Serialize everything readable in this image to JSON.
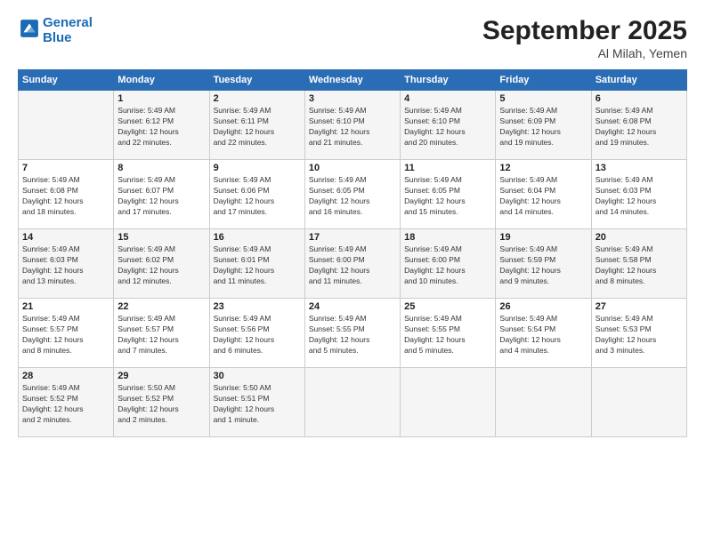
{
  "header": {
    "logo_line1": "General",
    "logo_line2": "Blue",
    "title": "September 2025",
    "subtitle": "Al Milah, Yemen"
  },
  "days_of_week": [
    "Sunday",
    "Monday",
    "Tuesday",
    "Wednesday",
    "Thursday",
    "Friday",
    "Saturday"
  ],
  "weeks": [
    [
      {
        "day": "",
        "info": ""
      },
      {
        "day": "1",
        "info": "Sunrise: 5:49 AM\nSunset: 6:12 PM\nDaylight: 12 hours\nand 22 minutes."
      },
      {
        "day": "2",
        "info": "Sunrise: 5:49 AM\nSunset: 6:11 PM\nDaylight: 12 hours\nand 22 minutes."
      },
      {
        "day": "3",
        "info": "Sunrise: 5:49 AM\nSunset: 6:10 PM\nDaylight: 12 hours\nand 21 minutes."
      },
      {
        "day": "4",
        "info": "Sunrise: 5:49 AM\nSunset: 6:10 PM\nDaylight: 12 hours\nand 20 minutes."
      },
      {
        "day": "5",
        "info": "Sunrise: 5:49 AM\nSunset: 6:09 PM\nDaylight: 12 hours\nand 19 minutes."
      },
      {
        "day": "6",
        "info": "Sunrise: 5:49 AM\nSunset: 6:08 PM\nDaylight: 12 hours\nand 19 minutes."
      }
    ],
    [
      {
        "day": "7",
        "info": "Sunrise: 5:49 AM\nSunset: 6:08 PM\nDaylight: 12 hours\nand 18 minutes."
      },
      {
        "day": "8",
        "info": "Sunrise: 5:49 AM\nSunset: 6:07 PM\nDaylight: 12 hours\nand 17 minutes."
      },
      {
        "day": "9",
        "info": "Sunrise: 5:49 AM\nSunset: 6:06 PM\nDaylight: 12 hours\nand 17 minutes."
      },
      {
        "day": "10",
        "info": "Sunrise: 5:49 AM\nSunset: 6:05 PM\nDaylight: 12 hours\nand 16 minutes."
      },
      {
        "day": "11",
        "info": "Sunrise: 5:49 AM\nSunset: 6:05 PM\nDaylight: 12 hours\nand 15 minutes."
      },
      {
        "day": "12",
        "info": "Sunrise: 5:49 AM\nSunset: 6:04 PM\nDaylight: 12 hours\nand 14 minutes."
      },
      {
        "day": "13",
        "info": "Sunrise: 5:49 AM\nSunset: 6:03 PM\nDaylight: 12 hours\nand 14 minutes."
      }
    ],
    [
      {
        "day": "14",
        "info": "Sunrise: 5:49 AM\nSunset: 6:03 PM\nDaylight: 12 hours\nand 13 minutes."
      },
      {
        "day": "15",
        "info": "Sunrise: 5:49 AM\nSunset: 6:02 PM\nDaylight: 12 hours\nand 12 minutes."
      },
      {
        "day": "16",
        "info": "Sunrise: 5:49 AM\nSunset: 6:01 PM\nDaylight: 12 hours\nand 11 minutes."
      },
      {
        "day": "17",
        "info": "Sunrise: 5:49 AM\nSunset: 6:00 PM\nDaylight: 12 hours\nand 11 minutes."
      },
      {
        "day": "18",
        "info": "Sunrise: 5:49 AM\nSunset: 6:00 PM\nDaylight: 12 hours\nand 10 minutes."
      },
      {
        "day": "19",
        "info": "Sunrise: 5:49 AM\nSunset: 5:59 PM\nDaylight: 12 hours\nand 9 minutes."
      },
      {
        "day": "20",
        "info": "Sunrise: 5:49 AM\nSunset: 5:58 PM\nDaylight: 12 hours\nand 8 minutes."
      }
    ],
    [
      {
        "day": "21",
        "info": "Sunrise: 5:49 AM\nSunset: 5:57 PM\nDaylight: 12 hours\nand 8 minutes."
      },
      {
        "day": "22",
        "info": "Sunrise: 5:49 AM\nSunset: 5:57 PM\nDaylight: 12 hours\nand 7 minutes."
      },
      {
        "day": "23",
        "info": "Sunrise: 5:49 AM\nSunset: 5:56 PM\nDaylight: 12 hours\nand 6 minutes."
      },
      {
        "day": "24",
        "info": "Sunrise: 5:49 AM\nSunset: 5:55 PM\nDaylight: 12 hours\nand 5 minutes."
      },
      {
        "day": "25",
        "info": "Sunrise: 5:49 AM\nSunset: 5:55 PM\nDaylight: 12 hours\nand 5 minutes."
      },
      {
        "day": "26",
        "info": "Sunrise: 5:49 AM\nSunset: 5:54 PM\nDaylight: 12 hours\nand 4 minutes."
      },
      {
        "day": "27",
        "info": "Sunrise: 5:49 AM\nSunset: 5:53 PM\nDaylight: 12 hours\nand 3 minutes."
      }
    ],
    [
      {
        "day": "28",
        "info": "Sunrise: 5:49 AM\nSunset: 5:52 PM\nDaylight: 12 hours\nand 2 minutes."
      },
      {
        "day": "29",
        "info": "Sunrise: 5:50 AM\nSunset: 5:52 PM\nDaylight: 12 hours\nand 2 minutes."
      },
      {
        "day": "30",
        "info": "Sunrise: 5:50 AM\nSunset: 5:51 PM\nDaylight: 12 hours\nand 1 minute."
      },
      {
        "day": "",
        "info": ""
      },
      {
        "day": "",
        "info": ""
      },
      {
        "day": "",
        "info": ""
      },
      {
        "day": "",
        "info": ""
      }
    ]
  ]
}
